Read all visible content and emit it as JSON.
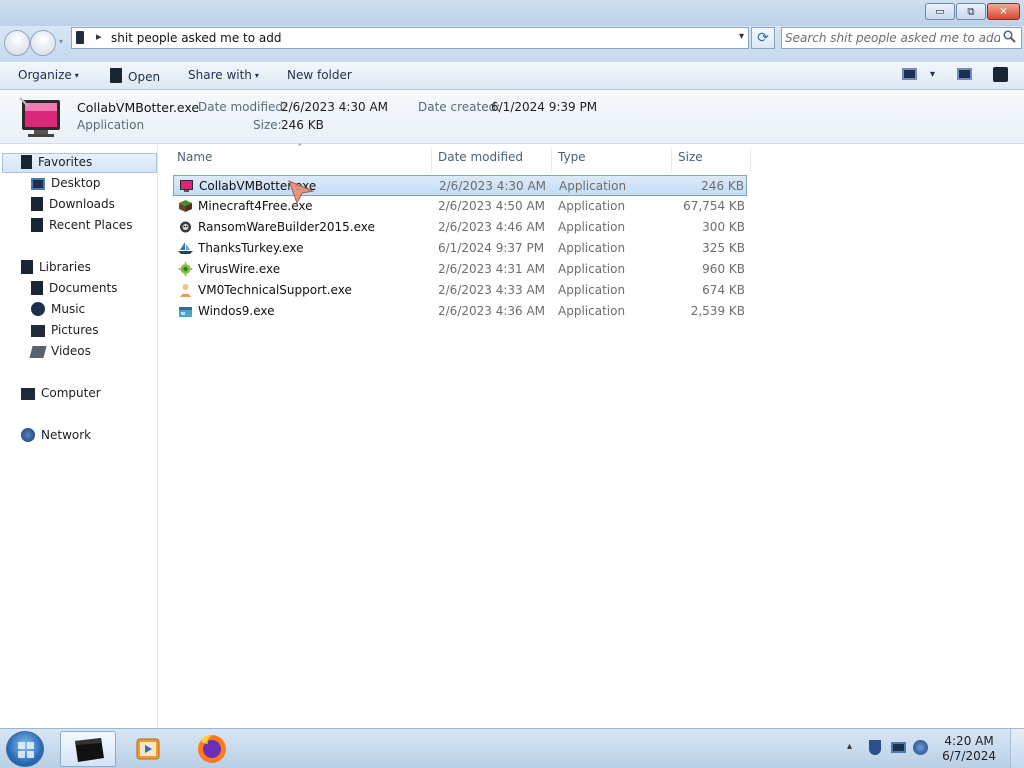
{
  "window": {
    "minimize_glyph": "▭",
    "maximize_glyph": "⧉",
    "close_glyph": "✕"
  },
  "navigation": {
    "breadcrumb_path": "shit people asked me to add",
    "breadcrumb_arrow": "▸",
    "dropdown_glyph": "▾",
    "refresh_glyph": "⟳",
    "search_placeholder": "Search shit people asked me to add",
    "search_icon": "search-icon"
  },
  "toolbar": {
    "organize_label": "Organize",
    "open_label": "Open",
    "share_with_label": "Share with",
    "new_folder_label": "New folder",
    "caret": "▾"
  },
  "details": {
    "file_name": "CollabVMBotter.exe",
    "file_type": "Application",
    "date_modified_label": "Date modified:",
    "date_modified_value": "2/6/2023 4:30 AM",
    "size_label": "Size:",
    "size_value": "246 KB",
    "date_created_label": "Date created:",
    "date_created_value": "6/1/2024 9:39 PM"
  },
  "leftnav": {
    "favorites": "Favorites",
    "desktop": "Desktop",
    "downloads": "Downloads",
    "recent_places": "Recent Places",
    "libraries": "Libraries",
    "documents": "Documents",
    "music": "Music",
    "pictures": "Pictures",
    "videos": "Videos",
    "computer": "Computer",
    "network": "Network"
  },
  "columns": {
    "name": "Name",
    "date_modified": "Date modified",
    "type": "Type",
    "size": "Size",
    "sort_indicator": "ˆ"
  },
  "files": [
    {
      "name": "CollabVMBotter.exe",
      "modified": "2/6/2023 4:30 AM",
      "type": "Application",
      "size": "246 KB",
      "icon": "monitor-app-icon",
      "selected": true
    },
    {
      "name": "Minecraft4Free.exe",
      "modified": "2/6/2023 4:50 AM",
      "type": "Application",
      "size": "67,754 KB",
      "icon": "grass-block-icon"
    },
    {
      "name": "RansomWareBuilder2015.exe",
      "modified": "2/6/2023 4:46 AM",
      "type": "Application",
      "size": "300 KB",
      "icon": "gear-skull-icon"
    },
    {
      "name": "ThanksTurkey.exe",
      "modified": "6/1/2024 9:37 PM",
      "type": "Application",
      "size": "325 KB",
      "icon": "ship-icon"
    },
    {
      "name": "VirusWire.exe",
      "modified": "2/6/2023 4:31 AM",
      "type": "Application",
      "size": "960 KB",
      "icon": "virus-icon"
    },
    {
      "name": "VM0TechnicalSupport.exe",
      "modified": "2/6/2023 4:33 AM",
      "type": "Application",
      "size": "674 KB",
      "icon": "support-person-icon"
    },
    {
      "name": "Windos9.exe",
      "modified": "2/6/2023 4:36 AM",
      "type": "Application",
      "size": "2,539 KB",
      "icon": "window-app-icon"
    }
  ],
  "taskbar": {
    "apps": [
      "explorer-icon",
      "media-player-icon",
      "firefox-icon"
    ],
    "tray_arrow": "▴",
    "clock_time": "4:20 AM",
    "clock_date": "6/7/2024"
  },
  "colors": {
    "selection_bg": "#c4dcf5",
    "selection_border": "#7da2ce",
    "toolbar_text": "#1e3050",
    "muted_text": "#6d6d6d"
  }
}
